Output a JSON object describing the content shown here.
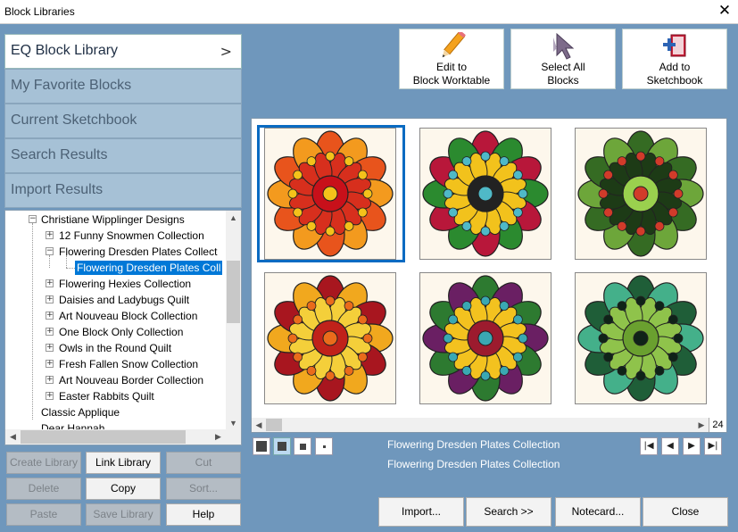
{
  "window": {
    "title": "Block Libraries",
    "close_glyph": "✕"
  },
  "libraries": [
    {
      "label": "EQ Block Library",
      "active": true
    },
    {
      "label": "My Favorite Blocks"
    },
    {
      "label": "Current Sketchbook"
    },
    {
      "label": "Search Results"
    },
    {
      "label": "Import Results"
    }
  ],
  "tree": {
    "items": [
      {
        "label": "Christiane Wipplinger Designs",
        "expander": "−"
      },
      {
        "label": "12 Funny Snowmen Collection",
        "expander": "+"
      },
      {
        "label": "Flowering Dresden Plates Collect",
        "expander": "−"
      },
      {
        "label": "Flowering Dresden Plates Coll",
        "selected": true
      },
      {
        "label": "Flowering Hexies Collection",
        "expander": "+"
      },
      {
        "label": "Daisies and Ladybugs Quilt",
        "expander": "+"
      },
      {
        "label": "Art Nouveau Block Collection",
        "expander": "+"
      },
      {
        "label": "One Block Only Collection",
        "expander": "+"
      },
      {
        "label": "Owls in the Round Quilt",
        "expander": "+"
      },
      {
        "label": "Fresh Fallen Snow Collection",
        "expander": "+"
      },
      {
        "label": "Art Nouveau Border Collection",
        "expander": "+"
      },
      {
        "label": "Easter Rabbits Quilt",
        "expander": "+"
      },
      {
        "label": "Classic Applique"
      },
      {
        "label": "Dear Hannah"
      }
    ]
  },
  "left_buttons": {
    "create_library": "Create Library",
    "link_library": "Link Library",
    "cut": "Cut",
    "delete": "Delete",
    "copy": "Copy",
    "sort": "Sort...",
    "paste": "Paste",
    "save_library": "Save Library",
    "help": "Help"
  },
  "toolbar": {
    "edit_line1": "Edit to",
    "edit_line2": "Block Worktable",
    "select_line1": "Select All",
    "select_line2": "Blocks",
    "add_line1": "Add to",
    "add_line2": "Sketchbook"
  },
  "gallery": {
    "count": "24",
    "blocks": [
      {
        "colors": [
          "#e8541c",
          "#f39a1e",
          "#d72f1d",
          "#f4c21a",
          "#c8101a"
        ]
      },
      {
        "colors": [
          "#b8173a",
          "#2b8a2f",
          "#f2c21c",
          "#4fb9c7",
          "#222222"
        ]
      },
      {
        "colors": [
          "#356b23",
          "#6da63a",
          "#1d3b16",
          "#d13b2a",
          "#9ad04e"
        ]
      },
      {
        "colors": [
          "#a8161f",
          "#f1a81e",
          "#f4cf3a",
          "#ea6b1b",
          "#c0221a"
        ]
      },
      {
        "colors": [
          "#2d7a30",
          "#6a1f63",
          "#f3c21f",
          "#3aa8b2",
          "#9c1b2e"
        ]
      },
      {
        "colors": [
          "#1f5e38",
          "#44b08a",
          "#8fc34b",
          "#0f2318",
          "#6aa02f"
        ]
      }
    ]
  },
  "info": {
    "line1": "Flowering Dresden Plates Collection",
    "line2": "Flowering Dresden Plates Collection"
  },
  "nav": {
    "first": "|◀",
    "prev": "◀",
    "next": "▶",
    "last": "▶|"
  },
  "bottom_buttons": {
    "import": "Import...",
    "search": "Search     >>",
    "notecard": "Notecard...",
    "close": "Close"
  }
}
